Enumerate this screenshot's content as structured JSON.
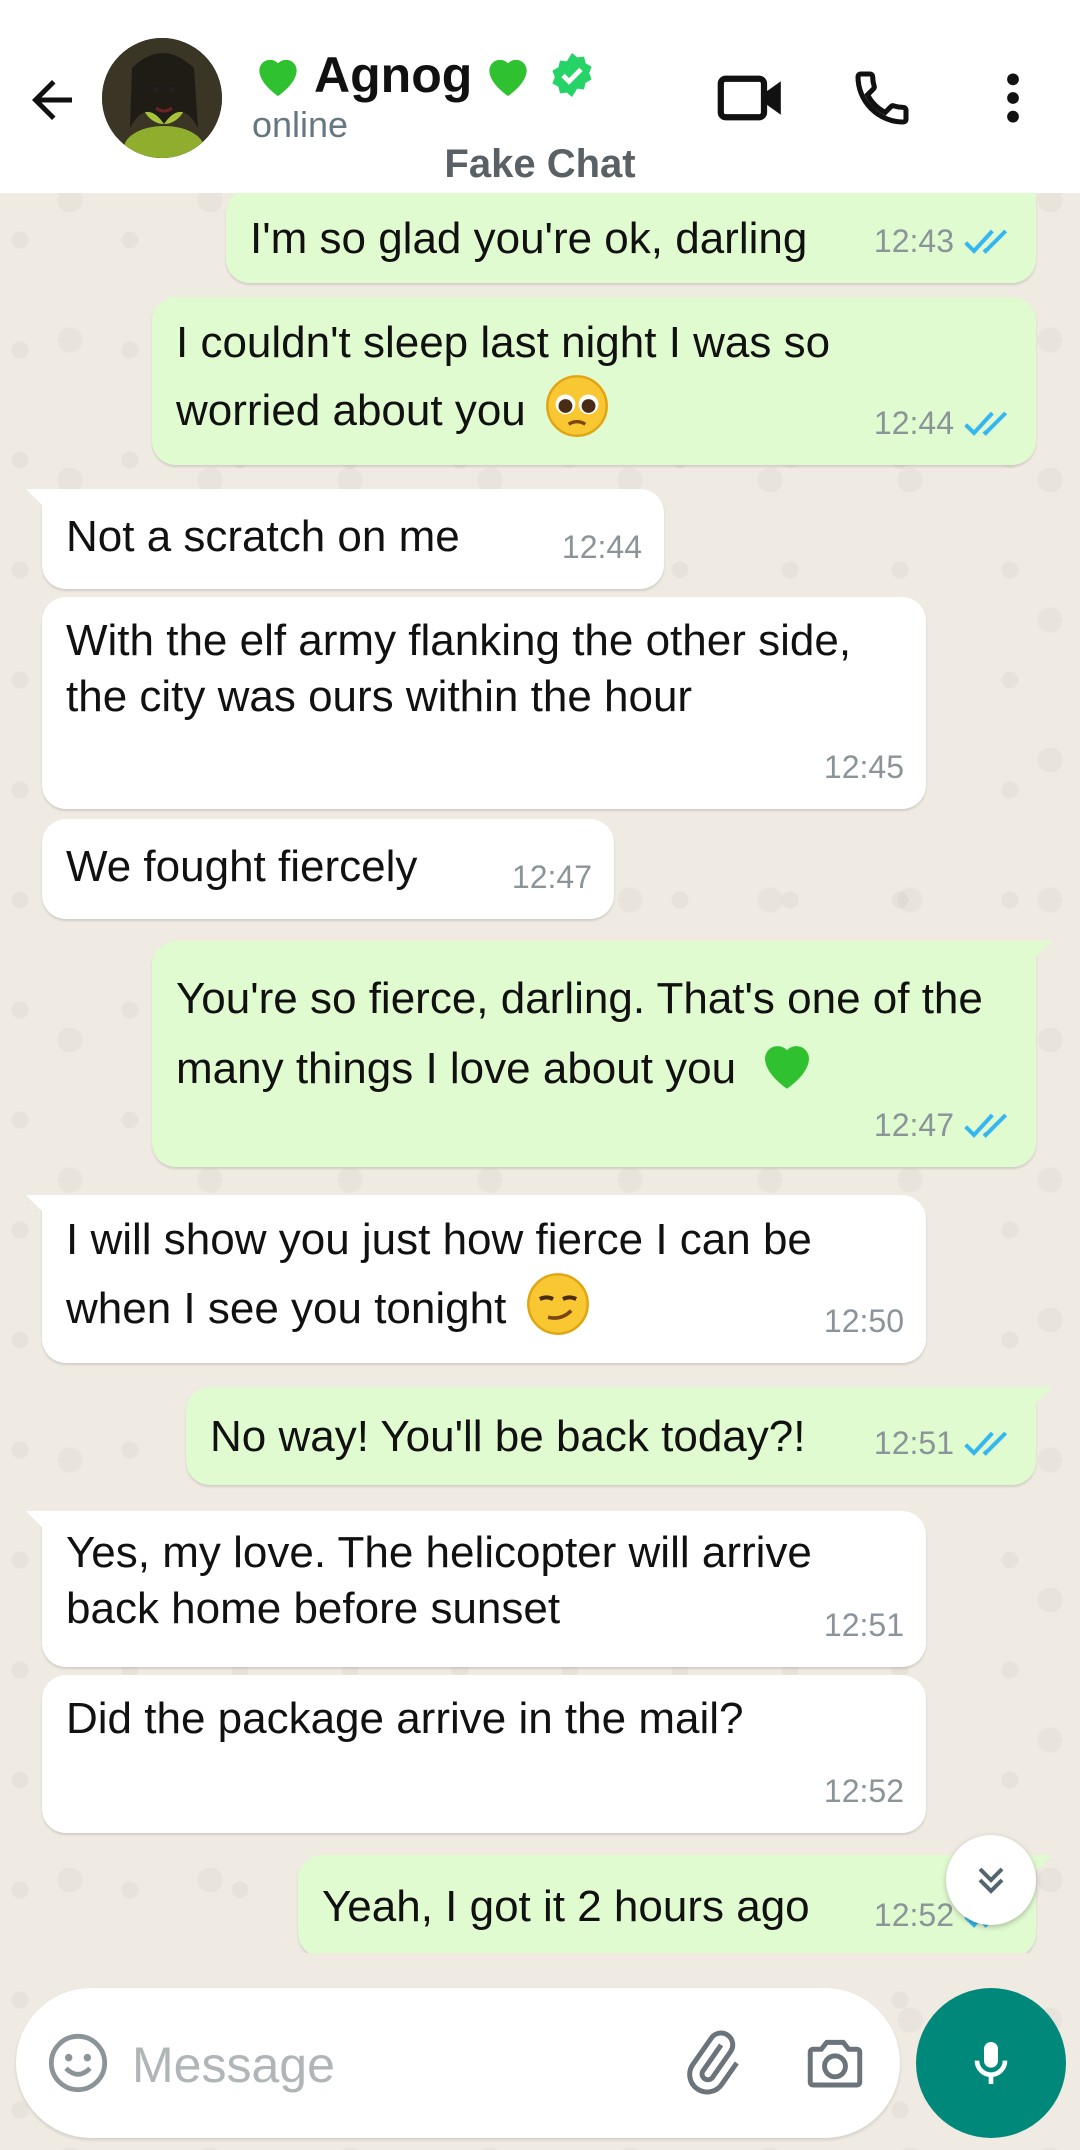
{
  "header": {
    "contact_name": "Agnog",
    "status": "online",
    "watermark": "Fake Chat"
  },
  "messages": [
    {
      "dir": "out",
      "text": "I'm so glad you're ok, darling",
      "time": "12:43",
      "read": true
    },
    {
      "dir": "out",
      "text": "I couldn't sleep last night I was so worried about you",
      "emoji": "pleading-face",
      "time": "12:44",
      "read": true
    },
    {
      "dir": "in",
      "text": "Not a scratch on me",
      "time": "12:44"
    },
    {
      "dir": "in",
      "text": "With the elf army flanking the other side, the city was ours within the hour",
      "time": "12:45"
    },
    {
      "dir": "in",
      "text": "We fought fiercely",
      "time": "12:47"
    },
    {
      "dir": "out",
      "text": "You're so fierce, darling. That's one of the many things I love about you",
      "emoji": "green-heart",
      "time": "12:47",
      "read": true
    },
    {
      "dir": "in",
      "text": "I will show you just how fierce I can be when I see you tonight",
      "emoji": "smirking-face",
      "time": "12:50"
    },
    {
      "dir": "out",
      "text": "No way! You'll be back today?!",
      "time": "12:51",
      "read": true
    },
    {
      "dir": "in",
      "text": "Yes, my love. The helicopter will arrive back home before sunset",
      "time": "12:51"
    },
    {
      "dir": "in",
      "text": "Did the package arrive in the mail?",
      "time": "12:52"
    },
    {
      "dir": "out",
      "text": "Yeah, I got it 2 hours ago",
      "time": "12:52",
      "read": true
    }
  ],
  "composer": {
    "placeholder": "Message"
  },
  "colors": {
    "outgoing_bubble": "#e1fbd0",
    "incoming_bubble": "#ffffff",
    "accent": "#00897b",
    "read_ticks": "#34b7f1",
    "verified": "#25d366"
  }
}
